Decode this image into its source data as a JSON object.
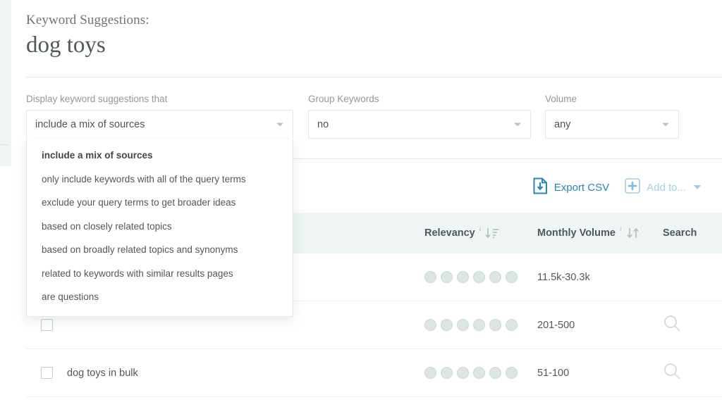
{
  "header": {
    "kicker": "Keyword Suggestions:",
    "query": "dog toys"
  },
  "filters": {
    "source_filter": {
      "label": "Display keyword suggestions that",
      "value": "include a mix of sources",
      "options": [
        "include a mix of sources",
        "only include keywords with all of the query terms",
        "exclude your query terms to get broader ideas",
        "based on closely related topics",
        "based on broadly related topics and synonyms",
        "related to keywords with similar results pages",
        "are questions"
      ]
    },
    "group_keywords": {
      "label": "Group Keywords",
      "value": "no"
    },
    "volume": {
      "label": "Volume",
      "value": "any"
    }
  },
  "toolbar": {
    "export_label": "Export CSV",
    "export_icon": "document-download-icon",
    "add_to_label": "Add to...",
    "add_to_icon": "plus-icon",
    "accent_color": "#2a86b4",
    "muted_color": "#a5cfe2"
  },
  "table": {
    "columns": {
      "keyword": "",
      "relevancy": "Relevancy",
      "volume": "Monthly Volume",
      "search": "Search"
    },
    "info_marker": "i",
    "sort": {
      "relevancy": "sort-descending-icon",
      "volume": "sort-updown-icon"
    },
    "rows": [
      {
        "keyword": "",
        "checked": false,
        "relevancy_dots": 6,
        "volume": "11.5k-30.3k",
        "search_icon": false
      },
      {
        "keyword": "",
        "checked": false,
        "relevancy_dots": 6,
        "volume": "201-500",
        "search_icon": true
      },
      {
        "keyword": "dog toys in bulk",
        "checked": false,
        "relevancy_dots": 6,
        "volume": "51-100",
        "search_icon": true
      }
    ]
  },
  "colors": {
    "header_band": "#eef5f4",
    "dot": "#dce6e4",
    "text": "#4f585a",
    "label": "#8e9a9c"
  }
}
